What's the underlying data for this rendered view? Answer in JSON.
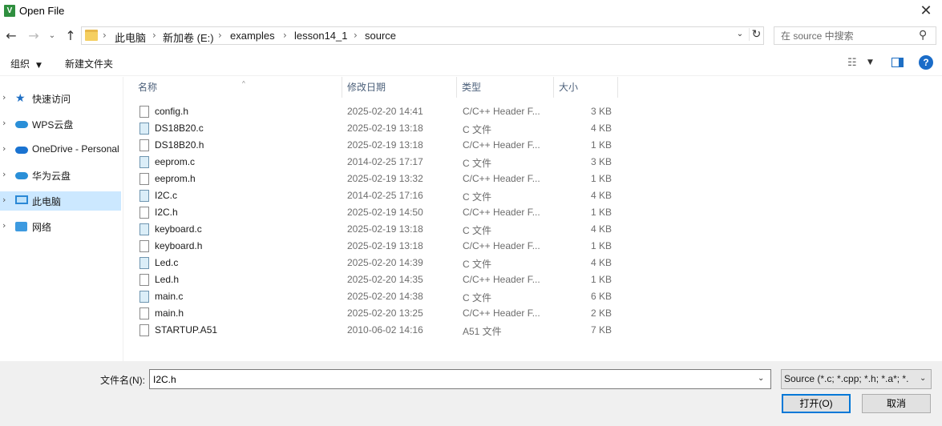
{
  "window": {
    "title": "Open File",
    "app_icon_glyph": "V",
    "close_glyph": "✕"
  },
  "nav": {
    "back_glyph": "←",
    "forward_glyph": "→",
    "recent_glyph": "⌄",
    "up_glyph": "↑",
    "address_segments": [
      "此电脑",
      "新加卷 (E:)",
      "examples",
      "lesson14_1",
      "source"
    ],
    "separator_glyph": "›",
    "refresh_glyph": "↻",
    "dropdown_glyph": "⌄",
    "search_placeholder": "在 source 中搜索",
    "search_glyph": "⚲"
  },
  "toolbar": {
    "organize_label": "组织",
    "organize_caret": "▼",
    "new_folder_label": "新建文件夹",
    "view_glyph": "☷",
    "view_caret": "▼",
    "help_glyph": "?"
  },
  "sidebar": {
    "chevron_glyph": "›",
    "star_glyph": "★",
    "items": [
      {
        "label": "快速访问",
        "icon": "star-icon",
        "selected": false
      },
      {
        "label": "WPS云盘",
        "icon": "cloud-icon",
        "selected": false
      },
      {
        "label": "OneDrive - Personal",
        "icon": "onedrive-icon",
        "selected": false
      },
      {
        "label": "华为云盘",
        "icon": "cloud-icon",
        "selected": false
      },
      {
        "label": "此电脑",
        "icon": "computer-icon",
        "selected": true
      },
      {
        "label": "网络",
        "icon": "network-icon",
        "selected": false
      }
    ]
  },
  "filelist": {
    "columns": [
      "名称",
      "修改日期",
      "类型",
      "大小"
    ],
    "sort_glyph": "^",
    "rows": [
      {
        "name": "config.h",
        "date": "2025-02-20 14:41",
        "type": "C/C++ Header F...",
        "size": "3 KB",
        "kind": "h"
      },
      {
        "name": "DS18B20.c",
        "date": "2025-02-19 13:18",
        "type": "C 文件",
        "size": "4 KB",
        "kind": "c"
      },
      {
        "name": "DS18B20.h",
        "date": "2025-02-19 13:18",
        "type": "C/C++ Header F...",
        "size": "1 KB",
        "kind": "h"
      },
      {
        "name": "eeprom.c",
        "date": "2014-02-25 17:17",
        "type": "C 文件",
        "size": "3 KB",
        "kind": "c"
      },
      {
        "name": "eeprom.h",
        "date": "2025-02-19 13:32",
        "type": "C/C++ Header F...",
        "size": "1 KB",
        "kind": "h"
      },
      {
        "name": "I2C.c",
        "date": "2014-02-25 17:16",
        "type": "C 文件",
        "size": "4 KB",
        "kind": "c"
      },
      {
        "name": "I2C.h",
        "date": "2025-02-19 14:50",
        "type": "C/C++ Header F...",
        "size": "1 KB",
        "kind": "h"
      },
      {
        "name": "keyboard.c",
        "date": "2025-02-19 13:18",
        "type": "C 文件",
        "size": "4 KB",
        "kind": "c"
      },
      {
        "name": "keyboard.h",
        "date": "2025-02-19 13:18",
        "type": "C/C++ Header F...",
        "size": "1 KB",
        "kind": "h"
      },
      {
        "name": "Led.c",
        "date": "2025-02-20 14:39",
        "type": "C 文件",
        "size": "4 KB",
        "kind": "c"
      },
      {
        "name": "Led.h",
        "date": "2025-02-20 14:35",
        "type": "C/C++ Header F...",
        "size": "1 KB",
        "kind": "h"
      },
      {
        "name": "main.c",
        "date": "2025-02-20 14:38",
        "type": "C 文件",
        "size": "6 KB",
        "kind": "c"
      },
      {
        "name": "main.h",
        "date": "2025-02-20 13:25",
        "type": "C/C++ Header F...",
        "size": "2 KB",
        "kind": "h"
      },
      {
        "name": "STARTUP.A51",
        "date": "2010-06-02 14:16",
        "type": "A51 文件",
        "size": "7 KB",
        "kind": "a51"
      }
    ]
  },
  "footer": {
    "filename_label": "文件名(N):",
    "filename_value": "I2C.h",
    "filename_caret": "⌄",
    "filter_value": "Source (*.c; *.cpp; *.h; *.a*; *.",
    "filter_caret": "⌄",
    "open_label": "打开(O)",
    "cancel_label": "取消"
  }
}
